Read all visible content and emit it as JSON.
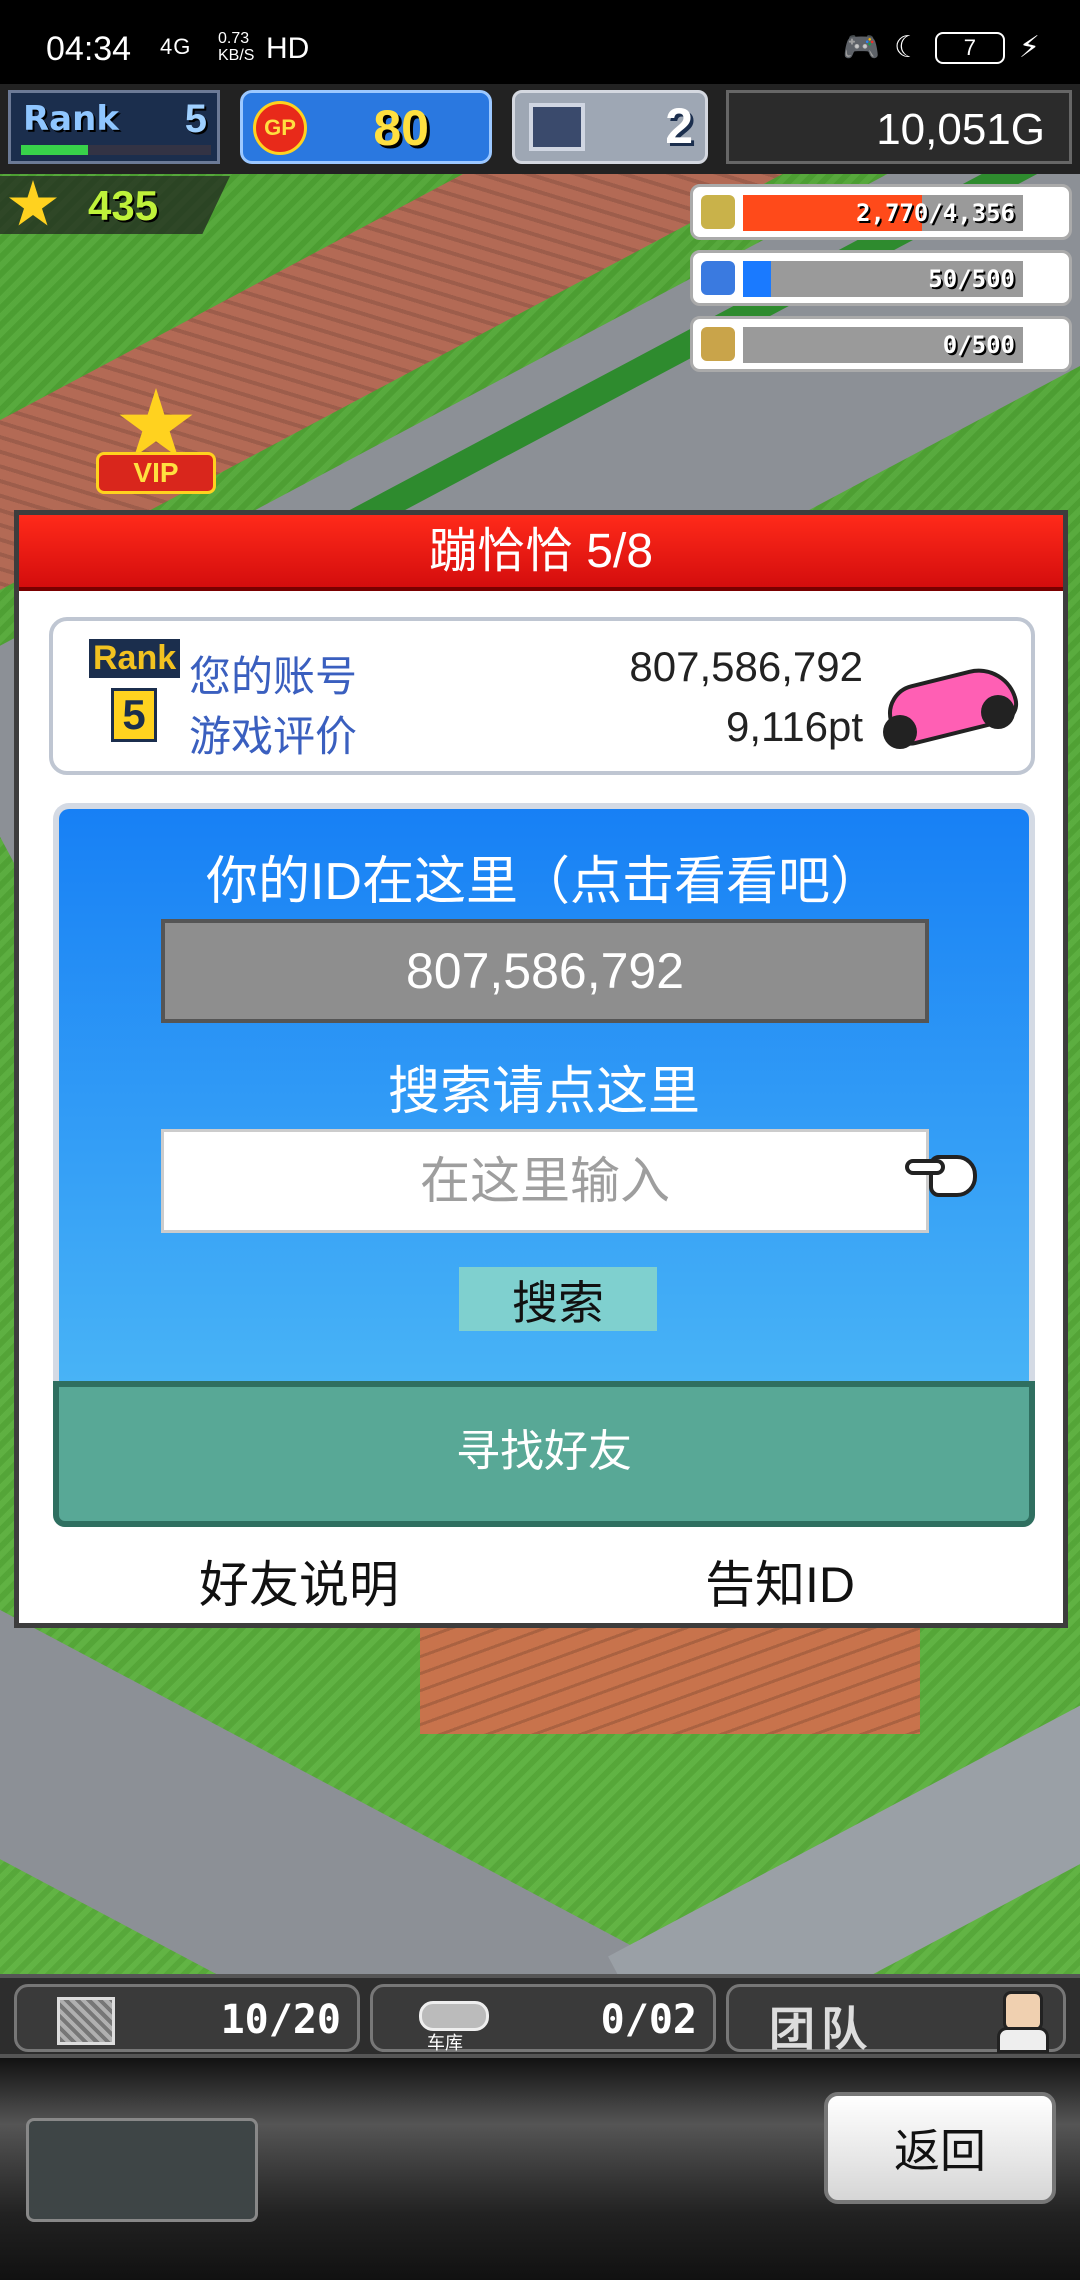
{
  "status_bar": {
    "time": "04:34",
    "signal": "4G",
    "speed": "0.73\nKB/S",
    "hd": "HD",
    "battery": "7"
  },
  "hud": {
    "rank_label": "Rank",
    "rank_value": "5",
    "rank_progress": 0.35,
    "gp_label": "GP",
    "gp_value": "80",
    "pc_value": "2",
    "gold": "10,051G",
    "stars": "435",
    "resources": [
      {
        "name": "coins",
        "text": "2,770/4,356",
        "fill": 0.64,
        "color": "#ff4a1a"
      },
      {
        "name": "fuel",
        "text": "50/500",
        "fill": 0.1,
        "color": "#1a7aff"
      },
      {
        "name": "wheat",
        "text": "0/500",
        "fill": 0.0,
        "color": "#e0a020"
      }
    ],
    "vip": "VIP"
  },
  "dialog": {
    "title": "蹦恰恰 5/8",
    "info": {
      "rank_label": "Rank",
      "rank_value": "5",
      "account_label": "您的账号",
      "account_value": "807,586,792",
      "rating_label": "游戏评价",
      "rating_value": "9,116pt"
    },
    "id_heading": "你的ID在这里（点击看看吧）",
    "id_value": "807,586,792",
    "search_heading": "搜索请点这里",
    "search_placeholder": "在这里输入",
    "search_value": "",
    "search_button": "搜索",
    "find_friends_button": "寻找好友",
    "friend_help_link": "好友说明",
    "share_id_link": "告知ID"
  },
  "bottom_hud": {
    "storage_count": "10/20",
    "garage_label": "车库",
    "garage_count": "0/02",
    "team_label": "团队",
    "back_button": "返回"
  }
}
